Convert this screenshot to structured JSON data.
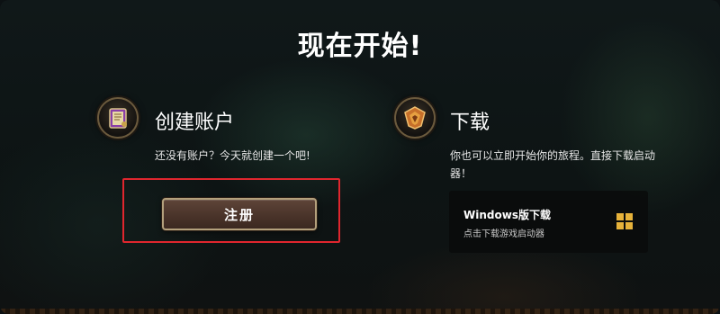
{
  "page": {
    "title": "现在开始!"
  },
  "register_section": {
    "icon": "spellbook-icon",
    "title": "创建账户",
    "description": "还没有账户？今天就创建一个吧!",
    "button_label": "注册"
  },
  "download_section": {
    "icon": "hearthstone-emblem-icon",
    "title": "下载",
    "description_line1": "你也可以立即开始你的旅程。直接下载启动",
    "description_line2": "器！",
    "card": {
      "title": "Windows版下载",
      "subtitle": "点击下载游戏启动器",
      "icon": "windows-icon"
    }
  },
  "colors": {
    "highlight_outline": "#e0262e",
    "button_border": "#b3a07c",
    "button_fill": "#4a342a",
    "windows_icon": "#e6b23a"
  }
}
